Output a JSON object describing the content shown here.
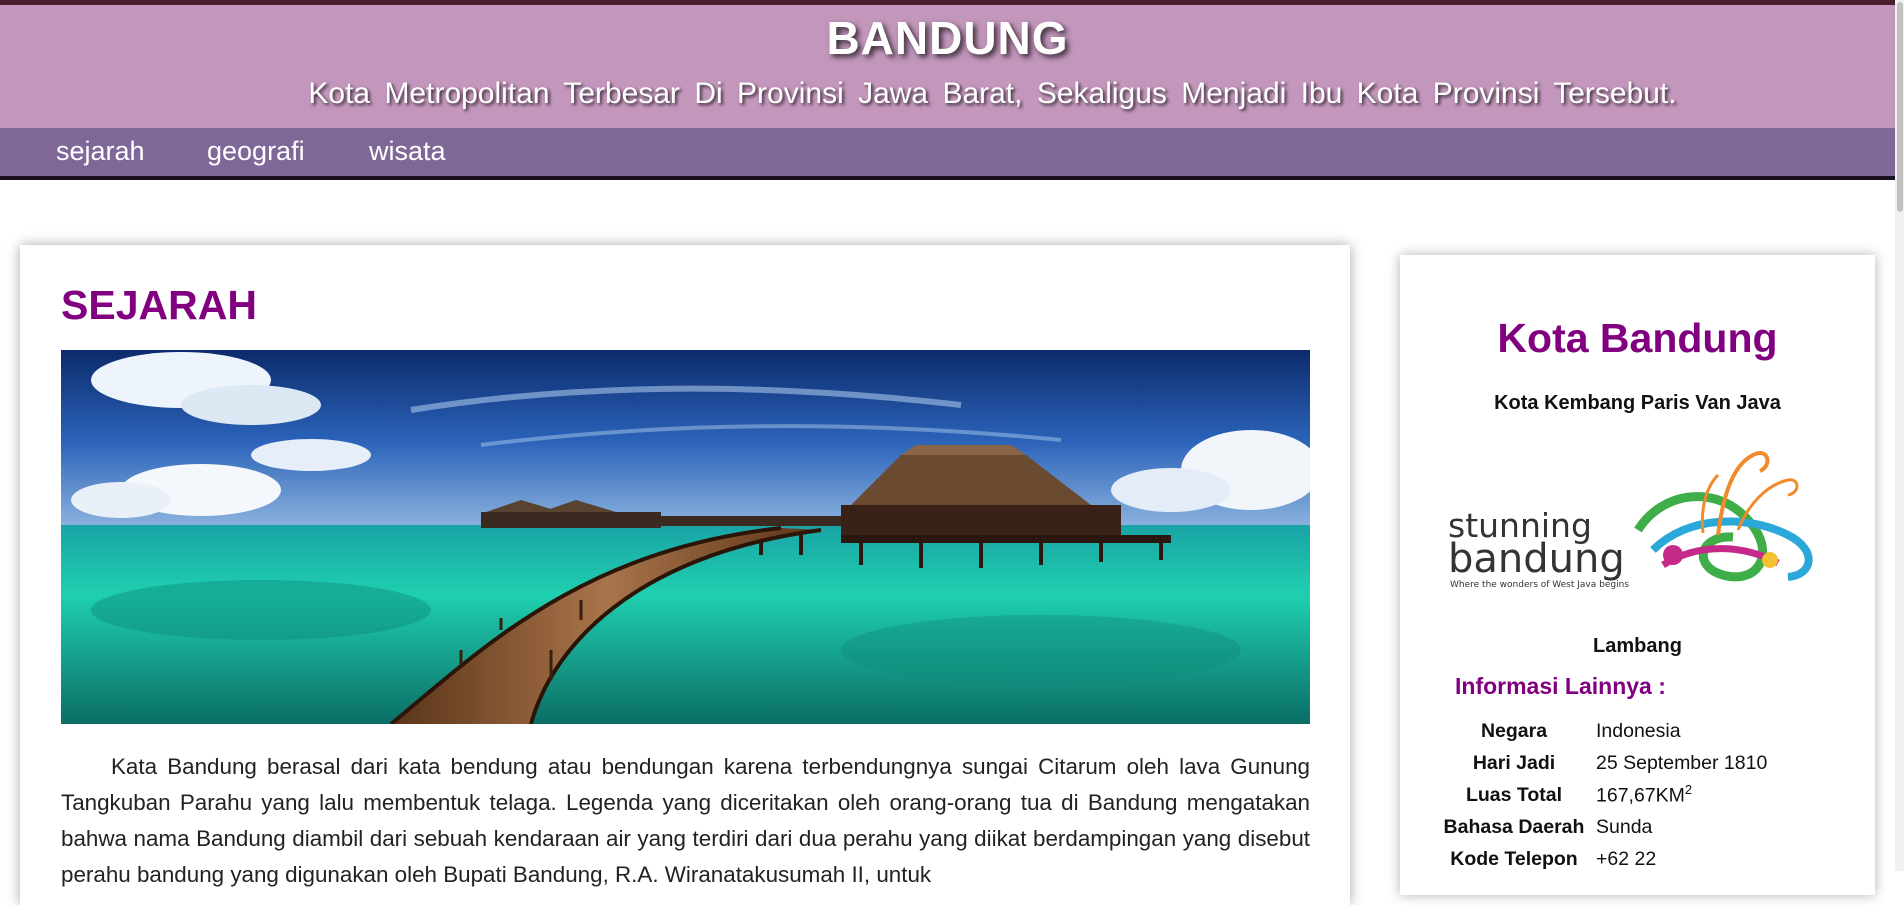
{
  "header": {
    "title": "BANDUNG",
    "subtitle": "Kota Metropolitan Terbesar Di Provinsi Jawa Barat, Sekaligus Menjadi Ibu Kota Provinsi Tersebut."
  },
  "nav": {
    "items": [
      "sejarah",
      "geografi",
      "wisata"
    ]
  },
  "main": {
    "section_title": "SEJARAH",
    "article_text": "Kata Bandung berasal dari kata bendung atau bendungan karena terbendungnya sungai Citarum oleh lava Gunung Tangkuban Parahu yang lalu membentuk telaga. Legenda yang diceritakan oleh orang-orang tua di Bandung mengatakan bahwa nama Bandung diambil dari sebuah kendaraan air yang terdiri dari dua perahu yang diikat berdampingan yang disebut perahu bandung yang digunakan oleh Bupati Bandung, R.A. Wiranatakusumah II, untuk"
  },
  "sidebar": {
    "title": "Kota Bandung",
    "tagline": "Kota Kembang Paris Van Java",
    "logo": {
      "word1": "stunning",
      "word2": "bandung",
      "tagline": "Where the wonders of West Java begins"
    },
    "logo_caption": "Lambang",
    "info_heading": "Informasi Lainnya :",
    "info": [
      {
        "key": "Negara",
        "value": "Indonesia"
      },
      {
        "key": "Hari Jadi",
        "value": "25 September 1810"
      },
      {
        "key": "Luas Total",
        "value": "167,67KM",
        "sup": "2"
      },
      {
        "key": "Bahasa Daerah",
        "value": "Sunda"
      },
      {
        "key": "Kode Telepon",
        "value": "+62 22"
      }
    ]
  },
  "colors": {
    "header_bg": "#c397bc",
    "nav_bg": "#7f6898",
    "accent": "#800080"
  }
}
